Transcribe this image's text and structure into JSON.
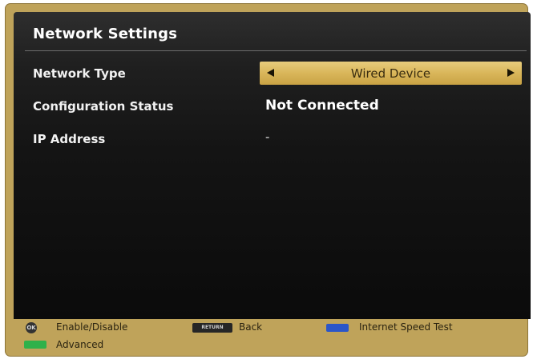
{
  "title": "Network Settings",
  "rows": [
    {
      "label": "Network Type",
      "value": "Wired Device"
    },
    {
      "label": "Configuration Status",
      "value": "Not Connected"
    },
    {
      "label": "IP Address",
      "value": "-"
    }
  ],
  "footer": {
    "ok_key": "OK",
    "ok_label": "Enable/Disable",
    "back_key": "RETURN",
    "back_label": "Back",
    "blue_label": "Internet Speed Test",
    "green_label": "Advanced"
  },
  "colors": {
    "frame": "#bfa35a",
    "selector": "#d9b65a",
    "blue_key": "#2b56c8",
    "green_key": "#2fb14a"
  }
}
